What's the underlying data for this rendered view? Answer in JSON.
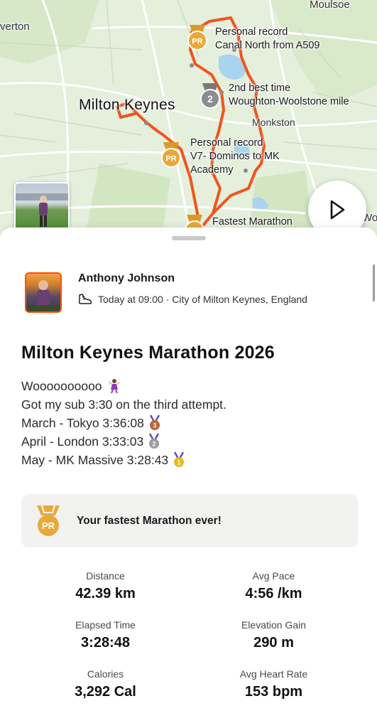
{
  "map": {
    "places": {
      "moulsoe": "Moulsoe",
      "overton": "verton",
      "milton_keynes": "Milton Keynes",
      "monkston": "Monkston",
      "edge_right": "Wo"
    },
    "segments": [
      {
        "line1": "Personal record",
        "line2": "Canal North from A509",
        "medal": "PR"
      },
      {
        "line1": "2nd best time",
        "line2": "Woughton-Woolstone mile",
        "medal": "2"
      },
      {
        "line1": "Personal record",
        "line2": "V7- Dominos to MK",
        "line3": "Academy",
        "medal": "PR"
      },
      {
        "line1": "Fastest Marathon",
        "medal": "PR"
      }
    ],
    "route_color": "#f0541e",
    "play_icon": "play-icon"
  },
  "activity": {
    "athlete": "Anthony Johnson",
    "sport_icon": "shoe-icon",
    "meta": "Today at 09:00 · City of Milton Keynes, England",
    "title": "Milton Keynes Marathon 2026",
    "description": [
      {
        "text": "Woooooooooo",
        "emoji": "dancer"
      },
      {
        "text": "Got my sub 3:30 on the third attempt.",
        "emoji": ""
      },
      {
        "text": "March - Tokyo 3:36:08",
        "emoji": "bronze-medal"
      },
      {
        "text": "April - London 3:33:03",
        "emoji": "silver-medal"
      },
      {
        "text": "May - MK Massive 3:28:43",
        "emoji": "gold-medal"
      }
    ]
  },
  "achievement": {
    "medal": "PR",
    "text": "Your fastest Marathon ever!"
  },
  "stats": [
    {
      "label": "Distance",
      "value": "42.39 km"
    },
    {
      "label": "Avg Pace",
      "value": "4:56 /km"
    },
    {
      "label": "Elapsed Time",
      "value": "3:28:48"
    },
    {
      "label": "Elevation Gain",
      "value": "290 m"
    },
    {
      "label": "Calories",
      "value": "3,292 Cal"
    },
    {
      "label": "Avg Heart Rate",
      "value": "153 bpm"
    }
  ],
  "colors": {
    "accent": "#fc5200",
    "gold": "#e8a93a",
    "silver": "#8a8d90",
    "bronze": "#b8683a"
  }
}
